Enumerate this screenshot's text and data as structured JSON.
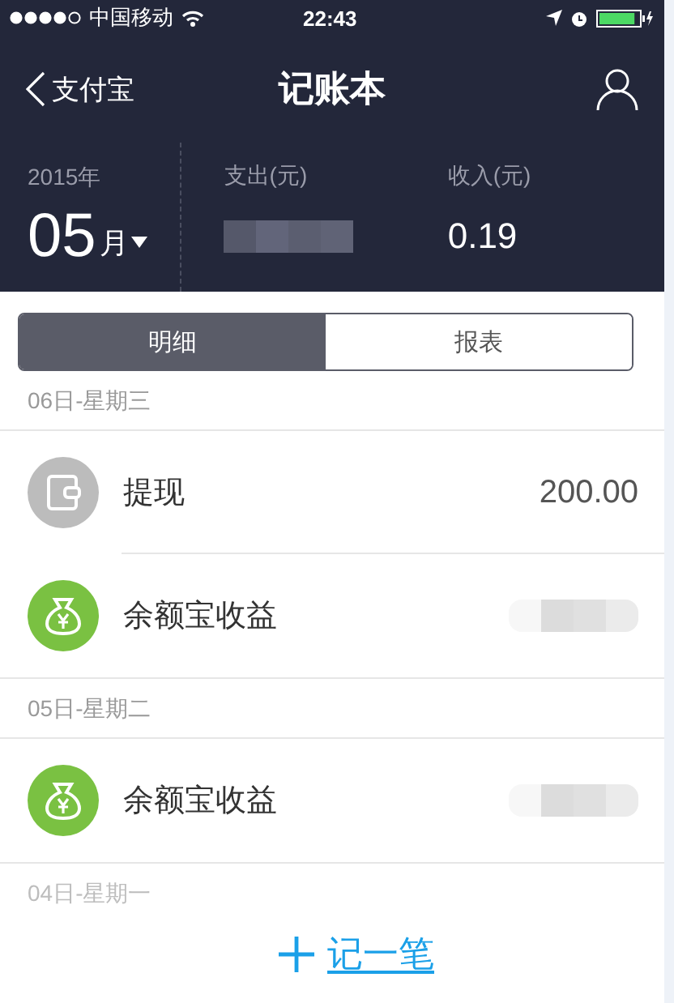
{
  "status_bar": {
    "carrier": "中国移动",
    "time": "22:43",
    "battery": {
      "level": 0.9
    }
  },
  "nav": {
    "back_label": "支付宝",
    "title": "记账本"
  },
  "summary": {
    "year": "2015年",
    "month": "05",
    "month_unit": "月",
    "expense_label": "支出(元)",
    "expense_redacted": true,
    "income_label": "收入(元)",
    "income": "0.19"
  },
  "tabs": [
    {
      "label": "明细",
      "selected": true
    },
    {
      "label": "报表",
      "selected": false
    }
  ],
  "groups": [
    {
      "date": "06日-星期三",
      "dimmed": false,
      "entries": [
        {
          "kind": "withdraw",
          "name": "提现",
          "amount": "200.00",
          "redacted": false
        },
        {
          "kind": "yield",
          "name": "余额宝收益",
          "redacted": true
        }
      ]
    },
    {
      "date": "05日-星期二",
      "dimmed": false,
      "entries": [
        {
          "kind": "yield",
          "name": "余额宝收益",
          "redacted": true
        }
      ]
    },
    {
      "date": "04日-星期一",
      "dimmed": true
    }
  ],
  "add_button": {
    "label": "记一笔"
  }
}
